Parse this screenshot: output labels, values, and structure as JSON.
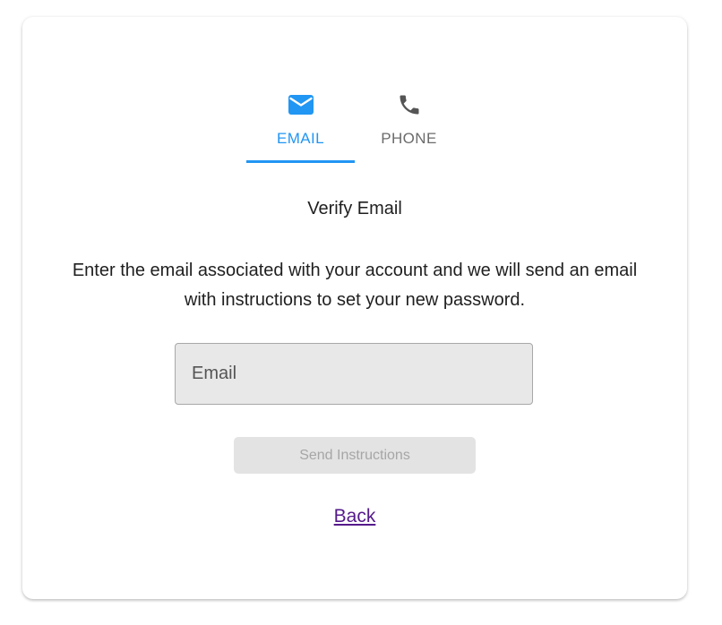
{
  "tabs": [
    {
      "label": "EMAIL",
      "icon": "mail-icon",
      "selected": true
    },
    {
      "label": "PHONE",
      "icon": "phone-icon",
      "selected": false
    }
  ],
  "form": {
    "heading": "Verify Email",
    "instructions": "Enter the email associated with your account and we will send an email with instructions to set your new password.",
    "email_placeholder": "Email",
    "email_value": "",
    "send_label": "Send Instructions",
    "back_label": "Back"
  },
  "colors": {
    "accent": "#2196f3",
    "tab_inactive": "#6b6b6b",
    "input_bg": "#e8e8e8",
    "button_disabled_bg": "#e3e3e3",
    "button_disabled_text": "#a6a6a6",
    "link_visited": "#551a8b"
  }
}
